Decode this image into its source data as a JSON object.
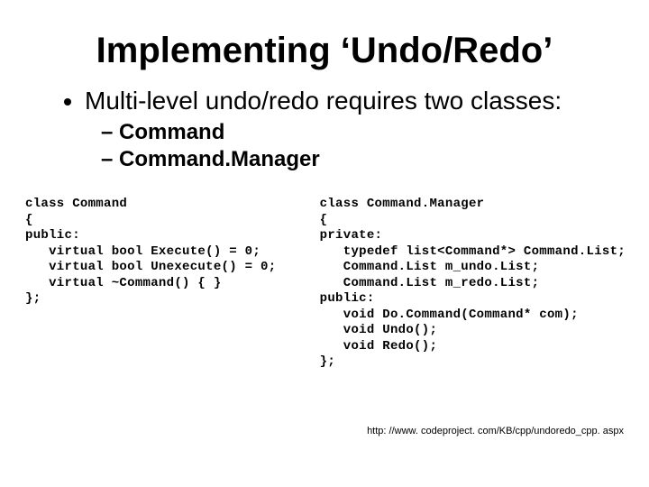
{
  "title": "Implementing ‘Undo/Redo’",
  "bullets": {
    "item1": "Multi-level undo/redo requires two classes:",
    "sub1": "Command",
    "sub2": "Command.Manager"
  },
  "code": {
    "left": "class Command\n{\npublic:\n   virtual bool Execute() = 0;\n   virtual bool Unexecute() = 0;\n   virtual ~Command() { }\n};",
    "right": "class Command.Manager\n{\nprivate:\n   typedef list<Command*> Command.List;\n   Command.List m_undo.List;\n   Command.List m_redo.List;\npublic:\n   void Do.Command(Command* com);\n   void Undo();\n   void Redo();\n};"
  },
  "footer": "http: //www. codeproject. com/KB/cpp/undoredo_cpp. aspx"
}
